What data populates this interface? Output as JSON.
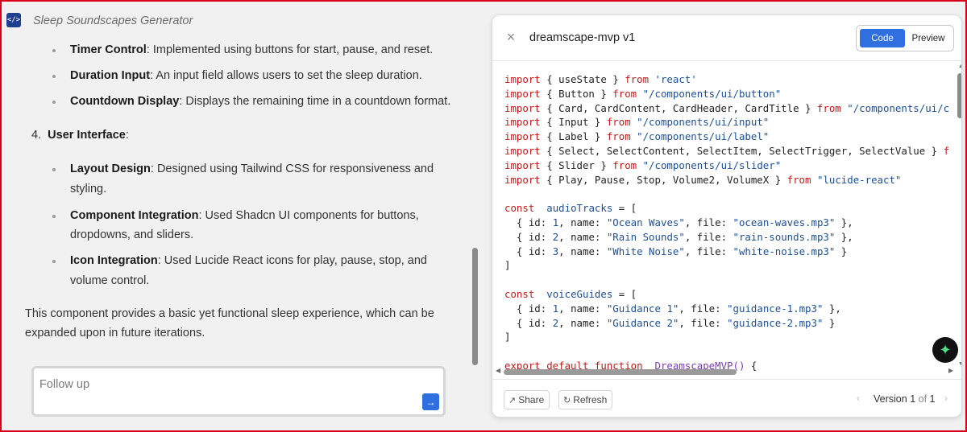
{
  "app": {
    "title": "Sleep Soundscapes Generator",
    "logo_glyph": "</>"
  },
  "chat": {
    "timer_items": [
      {
        "term": "Timer Control",
        "text": ": Implemented using buttons for start, pause, and reset."
      },
      {
        "term": "Duration Input",
        "text": ": An input field allows users to set the sleep duration."
      },
      {
        "term": "Countdown Display",
        "text": ": Displays the remaining time in a countdown format."
      }
    ],
    "section4": {
      "number": "4.",
      "title": "User Interface",
      "colon": ":"
    },
    "ui_items": [
      {
        "term": "Layout Design",
        "text": ": Designed using Tailwind CSS for responsiveness and",
        "cont": "styling."
      },
      {
        "term": "Component Integration",
        "text": ": Used Shadcn UI components for buttons,",
        "cont": "dropdowns, and sliders."
      },
      {
        "term": "Icon Integration",
        "text": ": Used Lucide React icons for play, pause, stop, and",
        "cont": "volume control."
      }
    ],
    "summary_line1": "This component provides a basic yet functional sleep experience, which can be",
    "summary_line2": "expanded upon in future iterations.",
    "followup_placeholder": "Follow up",
    "send_icon": "arrow-right-icon"
  },
  "artifact": {
    "title": "dreamscape-mvp v1",
    "tabs": {
      "code": "Code",
      "preview": "Preview",
      "active": "Code"
    },
    "share_label": "Share",
    "refresh_label": "Refresh",
    "version": {
      "prefix": "Version",
      "current": "1",
      "of": "of",
      "total": "1"
    },
    "code_lines": [
      [
        [
          "kw",
          "import"
        ],
        [
          "",
          "{ useState } "
        ],
        [
          "kw",
          "from"
        ],
        [
          "",
          " "
        ],
        [
          "str",
          "'react'"
        ]
      ],
      [
        [
          "kw",
          "import"
        ],
        [
          "",
          "{ Button } "
        ],
        [
          "kw",
          "from"
        ],
        [
          "",
          " "
        ],
        [
          "str",
          "\"/components/ui/button\""
        ]
      ],
      [
        [
          "kw",
          "import"
        ],
        [
          "",
          "{ Card, CardContent, CardHeader, CardTitle } "
        ],
        [
          "kw",
          "from"
        ],
        [
          "",
          " "
        ],
        [
          "str",
          "\"/components/ui/c"
        ]
      ],
      [
        [
          "kw",
          "import"
        ],
        [
          "",
          "{ Input } "
        ],
        [
          "kw",
          "from"
        ],
        [
          "",
          " "
        ],
        [
          "str",
          "\"/components/ui/input\""
        ]
      ],
      [
        [
          "kw",
          "import"
        ],
        [
          "",
          "{ Label } "
        ],
        [
          "kw",
          "from"
        ],
        [
          "",
          " "
        ],
        [
          "str",
          "\"/components/ui/label\""
        ]
      ],
      [
        [
          "kw",
          "import"
        ],
        [
          "",
          "{ Select, SelectContent, SelectItem, SelectTrigger, SelectValue } "
        ],
        [
          "kw",
          "f"
        ]
      ],
      [
        [
          "kw",
          "import"
        ],
        [
          "",
          "{ Slider } "
        ],
        [
          "kw",
          "from"
        ],
        [
          "",
          " "
        ],
        [
          "str",
          "\"/components/ui/slider\""
        ]
      ],
      [
        [
          "kw",
          "import"
        ],
        [
          "",
          "{ Play, Pause, Stop, Volume2, VolumeX } "
        ],
        [
          "kw",
          "from"
        ],
        [
          "",
          " "
        ],
        [
          "str",
          "\"lucide-react\""
        ]
      ],
      [],
      [
        [
          "kw",
          "const"
        ],
        [
          "",
          " "
        ],
        [
          "str",
          "audioTracks"
        ],
        [
          "",
          " = ["
        ]
      ],
      [
        [
          "",
          "  { id: "
        ],
        [
          "str",
          "1"
        ],
        [
          "",
          ", name: "
        ],
        [
          "str",
          "\"Ocean Waves\""
        ],
        [
          "",
          ", file: "
        ],
        [
          "str",
          "\"ocean-waves.mp3\""
        ],
        [
          "",
          " },"
        ]
      ],
      [
        [
          "",
          "  { id: "
        ],
        [
          "str",
          "2"
        ],
        [
          "",
          ", name: "
        ],
        [
          "str",
          "\"Rain Sounds\""
        ],
        [
          "",
          ", file: "
        ],
        [
          "str",
          "\"rain-sounds.mp3\""
        ],
        [
          "",
          " },"
        ]
      ],
      [
        [
          "",
          "  { id: "
        ],
        [
          "str",
          "3"
        ],
        [
          "",
          ", name: "
        ],
        [
          "str",
          "\"White Noise\""
        ],
        [
          "",
          ", file: "
        ],
        [
          "str",
          "\"white-noise.mp3\""
        ],
        [
          "",
          " }"
        ]
      ],
      [
        [
          "",
          "]"
        ]
      ],
      [],
      [
        [
          "kw",
          "const"
        ],
        [
          "",
          " "
        ],
        [
          "str",
          "voiceGuides"
        ],
        [
          "",
          " = ["
        ]
      ],
      [
        [
          "",
          "  { id: "
        ],
        [
          "str",
          "1"
        ],
        [
          "",
          ", name: "
        ],
        [
          "str",
          "\"Guidance 1\""
        ],
        [
          "",
          ", file: "
        ],
        [
          "str",
          "\"guidance-1.mp3\""
        ],
        [
          "",
          " },"
        ]
      ],
      [
        [
          "",
          "  { id: "
        ],
        [
          "str",
          "2"
        ],
        [
          "",
          ", name: "
        ],
        [
          "str",
          "\"Guidance 2\""
        ],
        [
          "",
          ", file: "
        ],
        [
          "str",
          "\"guidance-2.mp3\""
        ],
        [
          "",
          " }"
        ]
      ],
      [
        [
          "",
          "]"
        ]
      ],
      [],
      [
        [
          "kw",
          "export default function"
        ],
        [
          "",
          " "
        ],
        [
          "fn",
          "DreamscapeMVP"
        ],
        [
          "fn",
          "()"
        ],
        [
          "",
          " {"
        ]
      ]
    ]
  },
  "colors": {
    "accent": "#2f6fe0",
    "keyword": "#c41a16",
    "string": "#1d4f99",
    "function": "#7a3db8",
    "frame_border": "#d9001b"
  }
}
